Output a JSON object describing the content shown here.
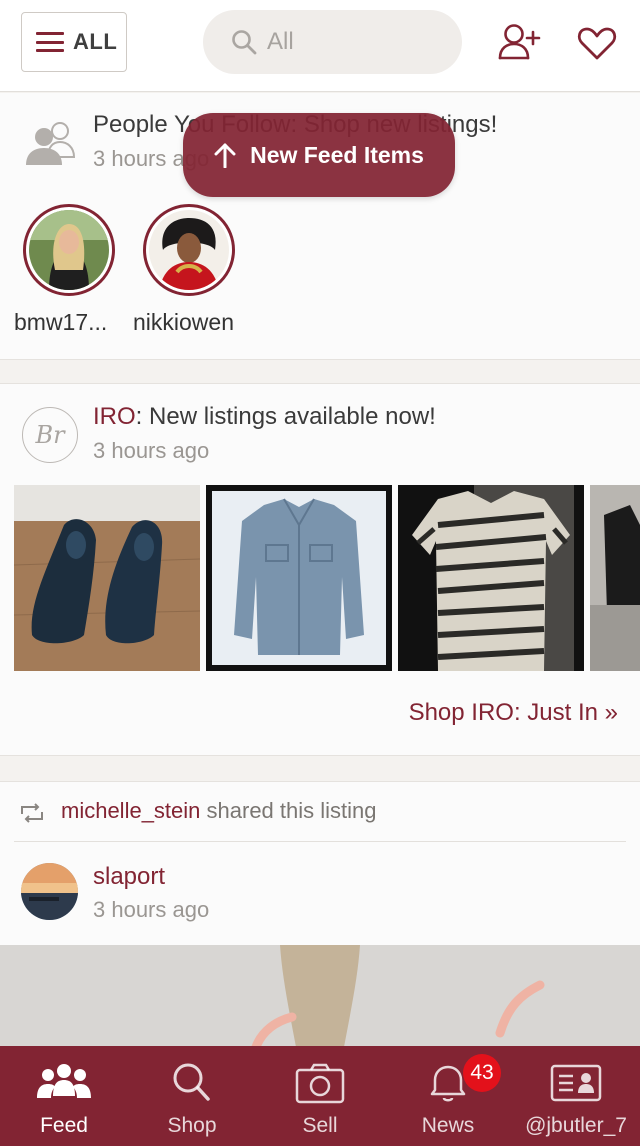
{
  "header": {
    "menu_label": "ALL",
    "search_placeholder": "All",
    "icons": [
      "menu-icon",
      "search-icon",
      "add-user-icon",
      "heart-icon"
    ]
  },
  "toast": {
    "label": "New Feed Items",
    "icon": "arrow-up-icon"
  },
  "follow_card": {
    "title": "People You Follow: Shop new listings!",
    "time": "3 hours ago",
    "users": [
      {
        "username": "bmw17..."
      },
      {
        "username": "nikkiowen"
      }
    ]
  },
  "brand_card": {
    "brand": "IRO",
    "title_rest": ": New listings available now!",
    "time": "3 hours ago",
    "listings": [
      "shoes",
      "denim-jacket",
      "zebra-shirt",
      "jacket"
    ],
    "shop_link": "Shop IRO: Just In »"
  },
  "share_card": {
    "user": "michelle_stein",
    "action": " shared this listing",
    "seller": "slaport",
    "time": "3 hours ago"
  },
  "nav": {
    "items": [
      {
        "label": "Feed",
        "icon": "people-icon"
      },
      {
        "label": "Shop",
        "icon": "search-icon"
      },
      {
        "label": "Sell",
        "icon": "camera-icon"
      },
      {
        "label": "News",
        "icon": "bell-icon",
        "badge": "43"
      },
      {
        "label": "@jbutler_7",
        "icon": "profile-card-icon"
      }
    ]
  },
  "colors": {
    "brand": "#822433",
    "badge": "#e3111b",
    "background": "#f4f2ef"
  }
}
